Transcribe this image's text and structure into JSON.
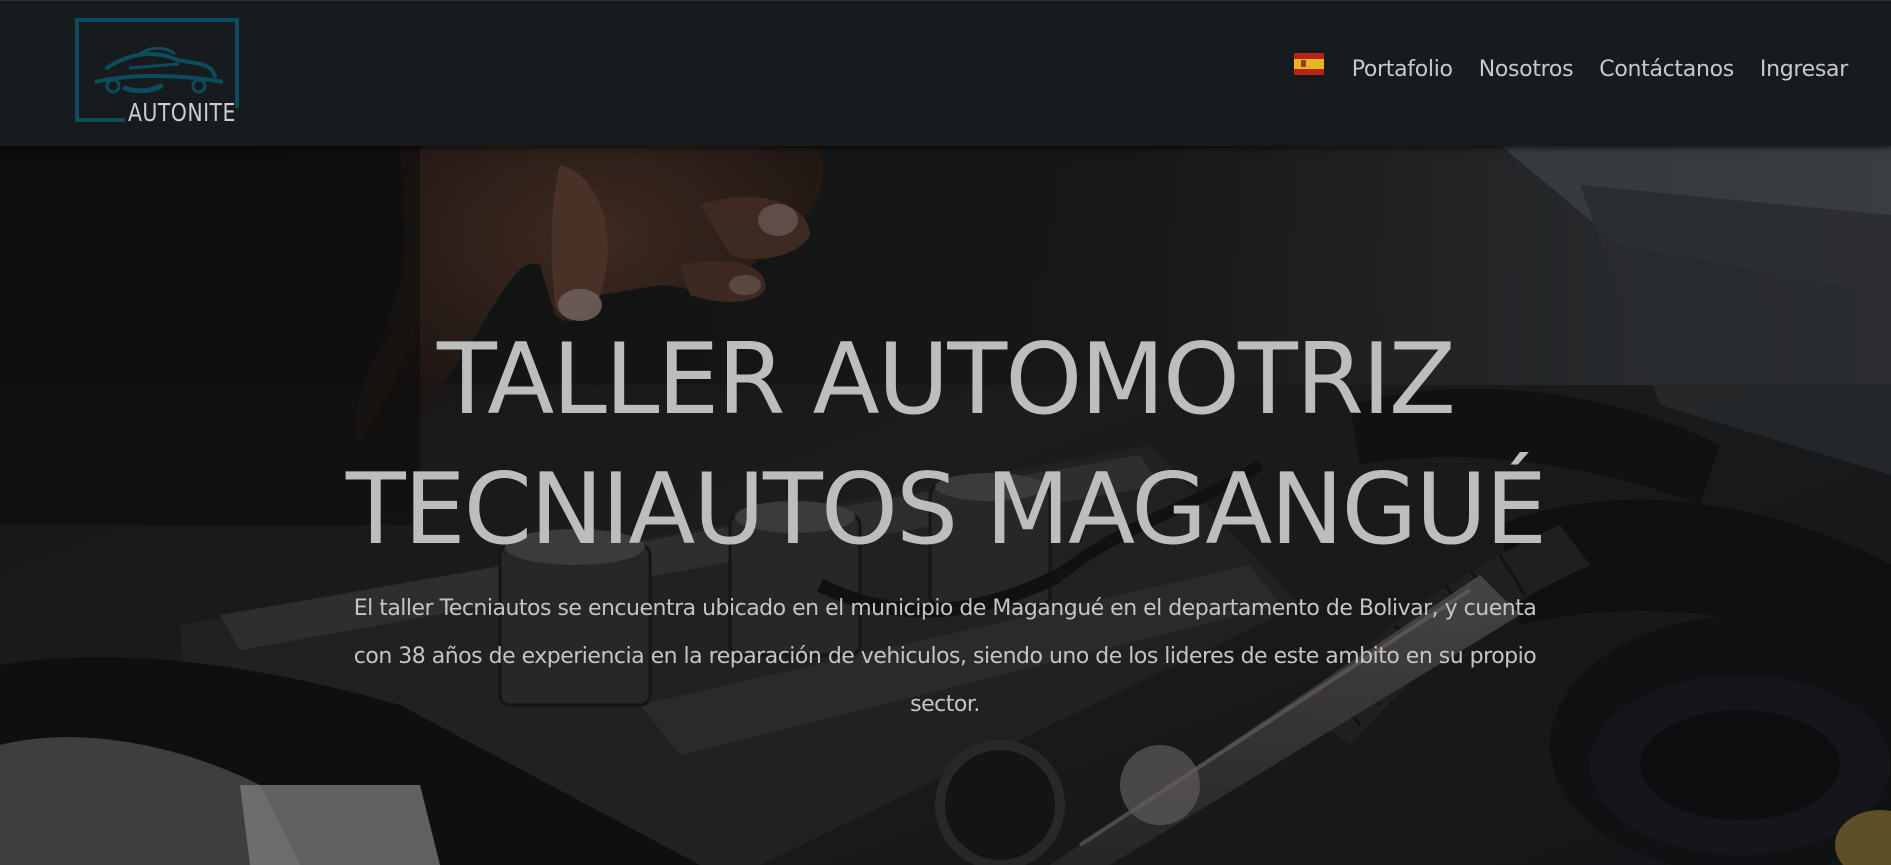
{
  "brand": {
    "logo_text": "AUTONITE",
    "logo_color": "#0b4d5c"
  },
  "nav": {
    "language_flag": "spain-flag-icon",
    "items": [
      {
        "label": "Portafolio"
      },
      {
        "label": "Nosotros"
      },
      {
        "label": "Contáctanos"
      },
      {
        "label": "Ingresar"
      }
    ]
  },
  "hero": {
    "title_line1": "TALLER AUTOMOTRIZ",
    "title_line2": "TECNIAUTOS MAGANGUÉ",
    "description": "El taller Tecniautos se encuentra ubicado en el municipio de Magangué en el departamento de Bolivar, y cuenta con 38 años de experiencia en la reparación de vehiculos, siendo uno de los lideres de este ambito en su propio sector.",
    "background": "car-engine-photo"
  },
  "colors": {
    "navbar_bg": "#171b1e",
    "nav_text": "#c6cacd",
    "hero_text": "#bdbdbd"
  }
}
